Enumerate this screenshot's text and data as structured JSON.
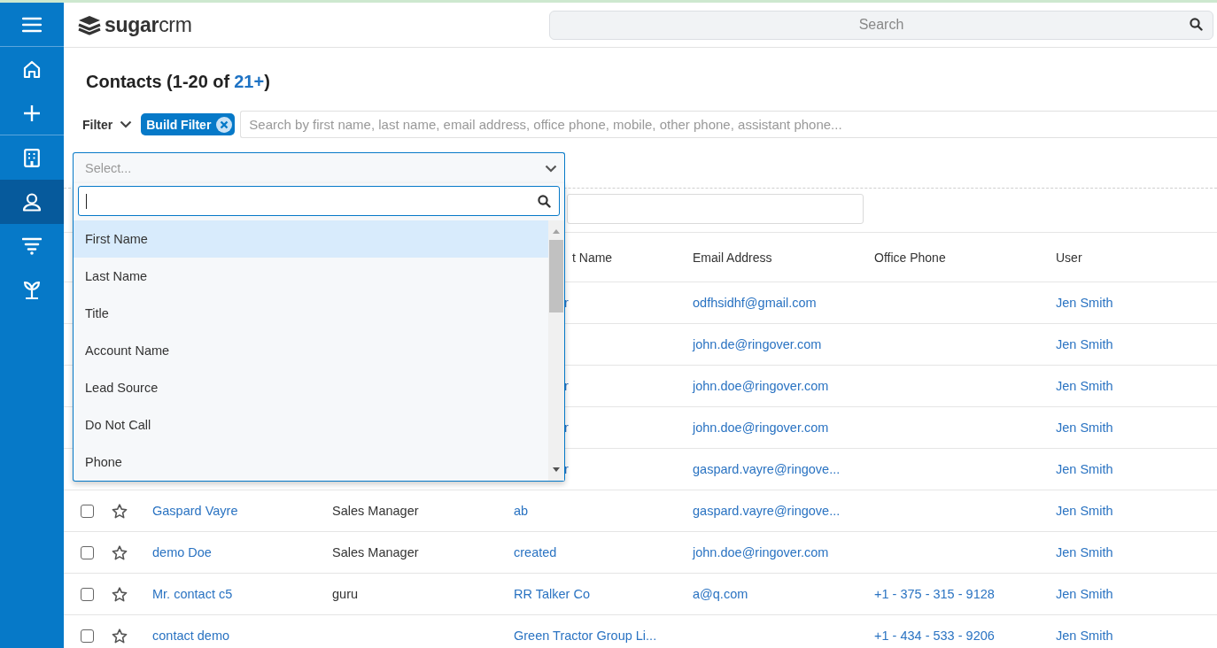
{
  "sidebar": {
    "items": [
      {
        "kind": "menu",
        "selected": false
      },
      {
        "kind": "home",
        "selected": false
      },
      {
        "kind": "plus",
        "selected": false
      },
      {
        "kind": "building",
        "selected": false
      },
      {
        "kind": "person",
        "selected": true
      },
      {
        "kind": "funnel",
        "selected": false
      },
      {
        "kind": "sprout",
        "selected": false
      }
    ]
  },
  "topbar": {
    "logo": "**sugar**crm",
    "search": {
      "placeholder": "Search"
    }
  },
  "page": {
    "title": "Contacts (1-20 of",
    "count": "21+",
    "title_end": ")"
  },
  "filter_bar": {
    "label": "Filter",
    "chip": "Build Filter",
    "search": {
      "placeholder": "Search by first name, last name, email address, office phone, mobile, other phone, assistant phone..."
    }
  },
  "filter_builder": {
    "field_select": {
      "placeholder": "Select...",
      "expanded": true,
      "options": [
        {
          "label": "First Name",
          "selected": true
        },
        {
          "label": "Last Name",
          "selected": false
        },
        {
          "label": "Title",
          "selected": false
        },
        {
          "label": "Account Name",
          "selected": false
        },
        {
          "label": "Lead Source",
          "selected": false
        },
        {
          "label": "Do Not Call",
          "selected": false
        },
        {
          "label": "Phone",
          "selected": false
        }
      ]
    }
  },
  "table": {
    "columns": [
      {
        "label": "t Name"
      },
      {
        "label": "Email Address"
      },
      {
        "label": "Office Phone"
      },
      {
        "label": "User"
      }
    ],
    "covered_rows": [
      {
        "account": "r",
        "email": "odfhsidhf@gmail.com",
        "user": "Jen Smith"
      },
      {
        "email": "john.de@ringover.com",
        "user": "Jen Smith"
      },
      {
        "account": "r",
        "email": "john.doe@ringover.com",
        "user": "Jen Smith"
      },
      {
        "account": "r",
        "email": "john.doe@ringover.com",
        "user": "Jen Smith"
      },
      {
        "account": "r",
        "email": "gaspard.vayre@ringove...",
        "user": "Jen Smith"
      }
    ],
    "rows": [
      {
        "checked": false,
        "favorite": false,
        "name": "Gaspard Vayre",
        "title": "Sales Manager",
        "account": "ab",
        "email": "gaspard.vayre@ringove...",
        "user": "Jen Smith"
      },
      {
        "checked": false,
        "favorite": false,
        "name": "demo Doe",
        "title": "Sales Manager",
        "account": "created",
        "email": "john.doe@ringover.com",
        "user": "Jen Smith"
      },
      {
        "checked": false,
        "favorite": false,
        "name": "Mr. contact c5",
        "title": "guru",
        "account": "RR Talker Co",
        "email": "a@q.com",
        "phone": "+1 - 375 - 315 - 9128",
        "user": "Jen Smith"
      },
      {
        "checked": false,
        "favorite": false,
        "name": "contact demo",
        "account": "Green Tractor Group Li...",
        "phone": "+1 - 434 - 533 - 9206",
        "user": "Jen Smith"
      }
    ]
  }
}
